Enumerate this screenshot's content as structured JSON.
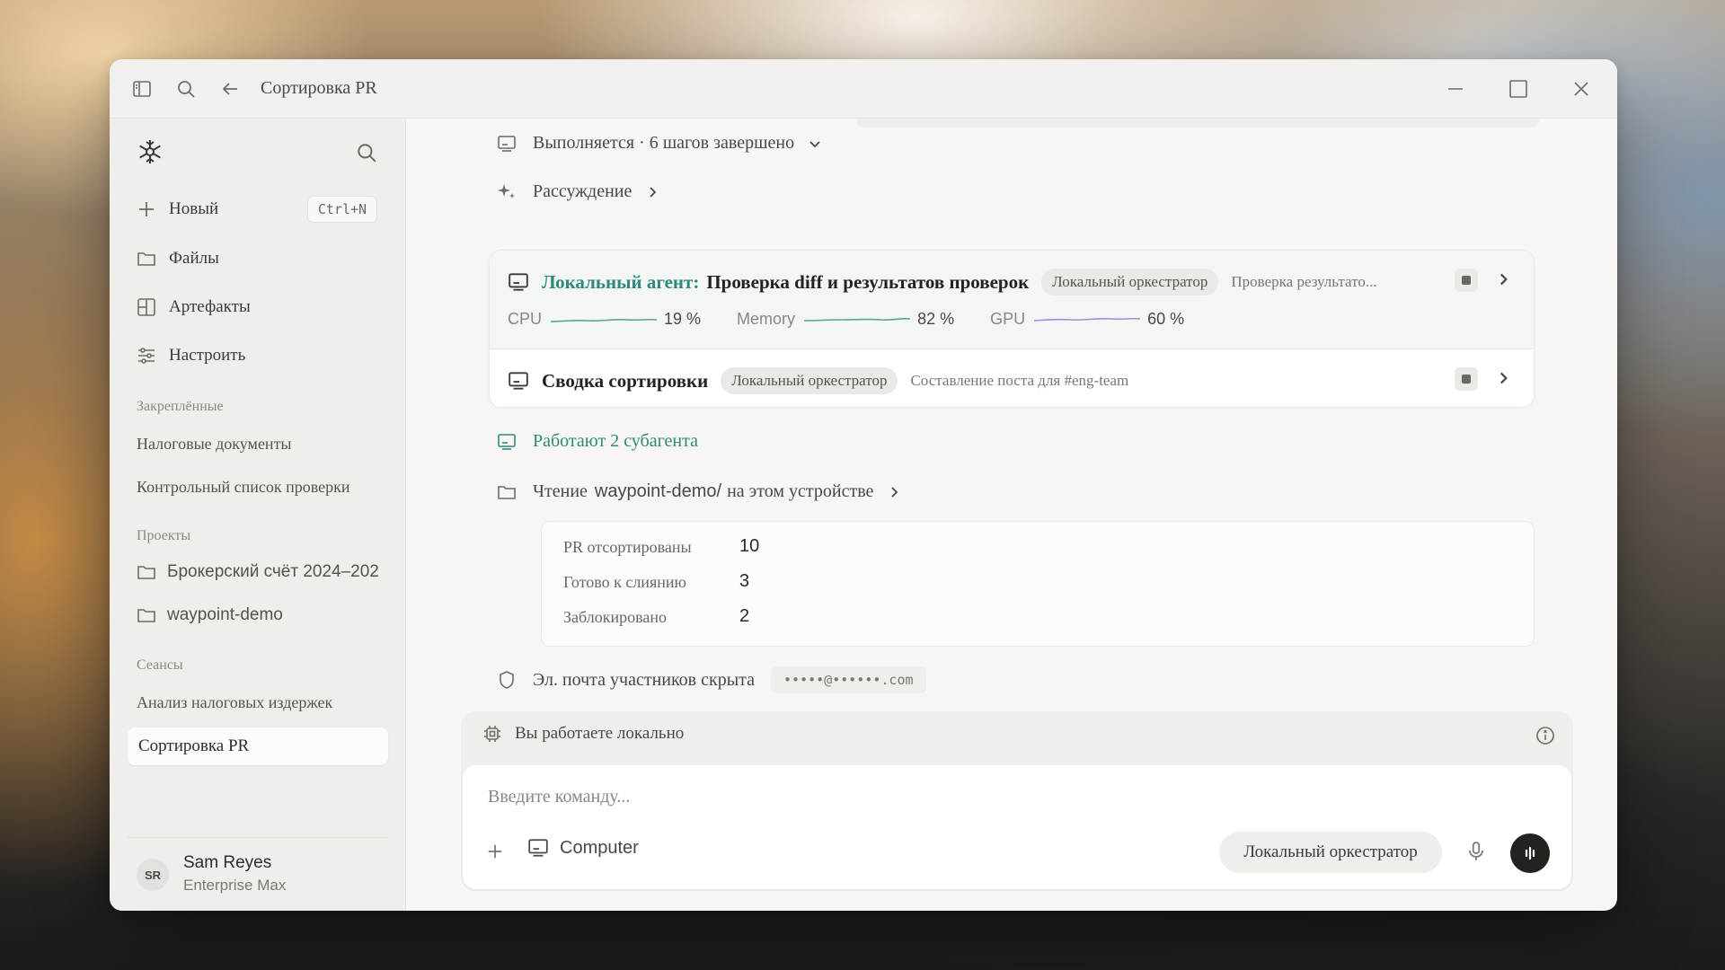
{
  "window": {
    "title": "Сортировка PR"
  },
  "sidebar": {
    "nav": [
      {
        "label": "Новый",
        "shortcut": "Ctrl+N"
      },
      {
        "label": "Файлы"
      },
      {
        "label": "Артефакты"
      },
      {
        "label": "Настроить"
      }
    ],
    "pinned_title": "Закреплённые",
    "pinned": [
      "Налоговые документы",
      "Контрольный список проверки"
    ],
    "projects_title": "Проекты",
    "projects": [
      "Брокерский счёт 2024–202",
      "waypoint-demo"
    ],
    "sessions_title": "Сеансы",
    "sessions": [
      "Анализ налоговых издержек",
      "Сортировка PR"
    ],
    "user": {
      "initials": "SR",
      "name": "Sam Reyes",
      "plan": "Enterprise Max"
    }
  },
  "main": {
    "status": "Выполняется · 6 шагов завершено",
    "reasoning": "Рассуждение",
    "agent_card": {
      "label": "Локальный агент:",
      "task": "Проверка diff и результатов проверок",
      "badge": "Локальный оркестратор",
      "substatus": "Проверка результато...",
      "metrics": [
        {
          "name": "CPU",
          "value": "19 %",
          "color": "#5aa58f",
          "level": 0.19
        },
        {
          "name": "Memory",
          "value": "82 %",
          "color": "#5aa58f",
          "level": 0.82
        },
        {
          "name": "GPU",
          "value": "60 %",
          "color": "#9c8fe0",
          "level": 0.6
        }
      ]
    },
    "summary_card": {
      "task": "Сводка сортировки",
      "badge": "Локальный оркестратор",
      "substatus": "Составление поста для #eng-team"
    },
    "subagents": "Работают 2 субагента",
    "reading": {
      "prefix": "Чтение",
      "path": "waypoint-demo/",
      "suffix": "на этом устройстве"
    },
    "stats": [
      {
        "label": "PR отсортированы",
        "value": "10"
      },
      {
        "label": "Готово к слиянию",
        "value": "3"
      },
      {
        "label": "Заблокировано",
        "value": "2"
      }
    ],
    "privacy": {
      "text": "Эл. почта участников скрыта",
      "masked": "•••••@••••••.com"
    }
  },
  "composer": {
    "local_notice": "Вы работаете локально",
    "placeholder": "Введите команду...",
    "computer_label": "Computer",
    "orchestrator": "Локальный оркестратор"
  },
  "colors": {
    "accent": "#2c8a7a",
    "background": "#f7f6f4"
  }
}
